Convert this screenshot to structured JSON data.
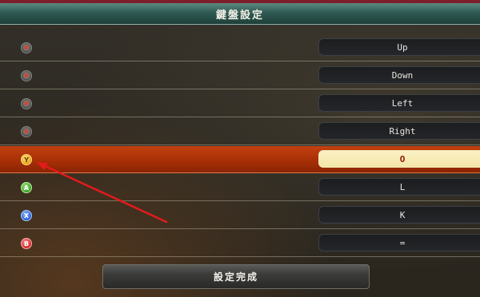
{
  "title": "鍵盤設定",
  "rows": [
    {
      "button_icon": "dpad-up-icon",
      "key": "Up"
    },
    {
      "button_icon": "dpad-down-icon",
      "key": "Down"
    },
    {
      "button_icon": "dpad-left-icon",
      "key": "Left"
    },
    {
      "button_icon": "dpad-right-icon",
      "key": "Right"
    },
    {
      "button_icon": "y-button-icon",
      "button_glyph": "Y",
      "key": "O",
      "selected": true
    },
    {
      "button_icon": "a-button-icon",
      "button_glyph": "A",
      "key": "L"
    },
    {
      "button_icon": "x-button-icon",
      "button_glyph": "X",
      "key": "K"
    },
    {
      "button_icon": "b-button-icon",
      "button_glyph": "B",
      "key": "="
    }
  ],
  "done_label": "設定完成",
  "colors": {
    "selected_row": "#b5360a",
    "annotation_arrow": "#e21b1b",
    "title_bar": "#2f5a53"
  }
}
